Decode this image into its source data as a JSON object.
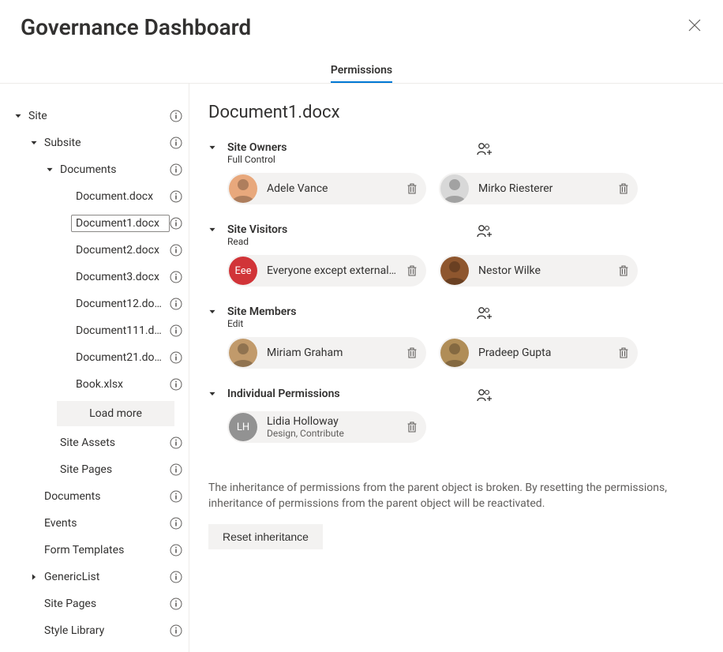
{
  "header": {
    "title": "Governance Dashboard",
    "tab_label": "Permissions"
  },
  "tree": {
    "root": "Site",
    "subsite": "Subsite",
    "documents_folder": "Documents",
    "docs": [
      "Document.docx",
      "Document1.docx",
      "Document2.docx",
      "Document3.docx",
      "Document12.docx",
      "Document111.docx",
      "Document21.docx",
      "Book.xlsx"
    ],
    "load_more": "Load more",
    "siblings": [
      "Site Assets",
      "Site Pages"
    ],
    "others": [
      "Documents",
      "Events",
      "Form Templates",
      "GenericList",
      "Site Pages",
      "Style Library"
    ]
  },
  "main": {
    "title": "Document1.docx",
    "groups": [
      {
        "name": "Site Owners",
        "permission": "Full Control",
        "members": [
          {
            "name": "Adele Vance",
            "avatarColor": "#e8a87c",
            "initials": ""
          },
          {
            "name": "Mirko Riesterer",
            "avatarColor": "#d8d8d8",
            "initials": ""
          }
        ]
      },
      {
        "name": "Site Visitors",
        "permission": "Read",
        "members": [
          {
            "name": "Everyone except external…",
            "avatarColor": "#d13438",
            "initials": "Eee"
          },
          {
            "name": "Nestor Wilke",
            "avatarColor": "#8e562e",
            "initials": ""
          }
        ]
      },
      {
        "name": "Site Members",
        "permission": "Edit",
        "members": [
          {
            "name": "Miriam Graham",
            "avatarColor": "#c19a6b",
            "initials": ""
          },
          {
            "name": "Pradeep Gupta",
            "avatarColor": "#b08d57",
            "initials": ""
          }
        ]
      }
    ],
    "individual_label": "Individual Permissions",
    "individual_members": [
      {
        "name": "Lidia Holloway",
        "subtext": "Design, Contribute",
        "avatarColor": "#929292",
        "initials": "LH"
      }
    ],
    "inheritance_note": "The inheritance of permissions from the parent object is broken. By resetting the permissions, inheritance of permissions from the parent object will be reactivated.",
    "reset_button": "Reset inheritance"
  }
}
